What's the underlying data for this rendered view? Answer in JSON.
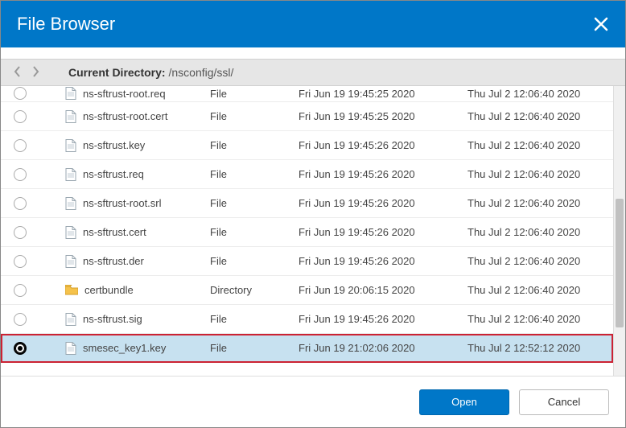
{
  "title": "File Browser",
  "currdir_label": "Current Directory:",
  "currdir_path": "/nsconfig/ssl/",
  "clipped_row": {
    "name": "ns-sftrust-root.req",
    "type": "File",
    "d1": "Fri Jun 19 19:45:25 2020",
    "d2": "Thu Jul  2 12:06:40 2020"
  },
  "rows": [
    {
      "name": "ns-sftrust-root.cert",
      "type": "File",
      "d1": "Fri Jun 19 19:45:25 2020",
      "d2": "Thu Jul  2 12:06:40 2020",
      "icon": "file",
      "selected": false
    },
    {
      "name": "ns-sftrust.key",
      "type": "File",
      "d1": "Fri Jun 19 19:45:26 2020",
      "d2": "Thu Jul  2 12:06:40 2020",
      "icon": "file",
      "selected": false
    },
    {
      "name": "ns-sftrust.req",
      "type": "File",
      "d1": "Fri Jun 19 19:45:26 2020",
      "d2": "Thu Jul  2 12:06:40 2020",
      "icon": "file",
      "selected": false
    },
    {
      "name": "ns-sftrust-root.srl",
      "type": "File",
      "d1": "Fri Jun 19 19:45:26 2020",
      "d2": "Thu Jul  2 12:06:40 2020",
      "icon": "file",
      "selected": false
    },
    {
      "name": "ns-sftrust.cert",
      "type": "File",
      "d1": "Fri Jun 19 19:45:26 2020",
      "d2": "Thu Jul  2 12:06:40 2020",
      "icon": "file",
      "selected": false
    },
    {
      "name": "ns-sftrust.der",
      "type": "File",
      "d1": "Fri Jun 19 19:45:26 2020",
      "d2": "Thu Jul  2 12:06:40 2020",
      "icon": "file",
      "selected": false
    },
    {
      "name": "certbundle",
      "type": "Directory",
      "d1": "Fri Jun 19 20:06:15 2020",
      "d2": "Thu Jul  2 12:06:40 2020",
      "icon": "folder",
      "selected": false
    },
    {
      "name": "ns-sftrust.sig",
      "type": "File",
      "d1": "Fri Jun 19 19:45:26 2020",
      "d2": "Thu Jul  2 12:06:40 2020",
      "icon": "file",
      "selected": false
    },
    {
      "name": "smesec_key1.key",
      "type": "File",
      "d1": "Fri Jun 19 21:02:06 2020",
      "d2": "Thu Jul  2 12:52:12 2020",
      "icon": "file",
      "selected": true
    }
  ],
  "buttons": {
    "open": "Open",
    "cancel": "Cancel"
  }
}
